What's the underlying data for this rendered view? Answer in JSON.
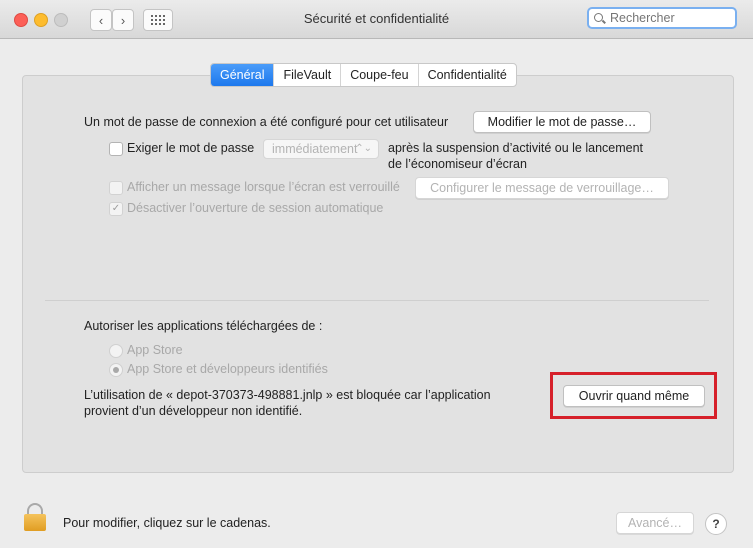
{
  "window": {
    "title": "Sécurité et confidentialité",
    "search_placeholder": "Rechercher"
  },
  "tabs": [
    {
      "label": "Général",
      "active": true
    },
    {
      "label": "FileVault",
      "active": false
    },
    {
      "label": "Coupe-feu",
      "active": false
    },
    {
      "label": "Confidentialité",
      "active": false
    }
  ],
  "general": {
    "password_set_text": "Un mot de passe de connexion a été configuré pour cet utilisateur",
    "change_password_button": "Modifier le mot de passe…",
    "require_password_label": "Exiger le mot de passe",
    "require_password_delay": "immédiatement",
    "require_password_after_line1": "après la suspension d’activité ou le lancement",
    "require_password_after_line2": "de l’économiseur d’écran",
    "show_message_label": "Afficher un message lorsque l’écran est verrouillé",
    "set_lock_message_button": "Configurer le message de verrouillage…",
    "disable_auto_login_label": "Désactiver l’ouverture de session automatique",
    "disable_auto_login_checked": true
  },
  "downloads": {
    "heading": "Autoriser les applications téléchargées de :",
    "option_app_store": "App Store",
    "option_app_store_identified": "App Store et développeurs identifiés",
    "selected": "App Store et développeurs identifiés",
    "blocked_message_line1": "L’utilisation de « depot-370373-498881.jnlp » est bloquée car l’application",
    "blocked_message_line2": "provient d’un développeur non identifié.",
    "open_anyway_button": "Ouvrir quand même",
    "highlight_color": "#d6202a"
  },
  "footer": {
    "lock_text": "Pour modifier, cliquez sur le cadenas.",
    "advanced_button": "Avancé…",
    "help_button": "?"
  },
  "colors": {
    "accent": "#1d78ed",
    "traffic_close": "#fc5f57",
    "traffic_minimize": "#fdbc2e"
  }
}
